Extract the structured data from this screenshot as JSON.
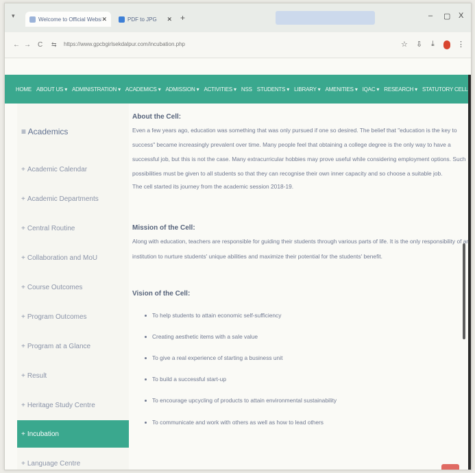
{
  "browser": {
    "tabs": [
      {
        "label": "Welcome to Official Website o",
        "close": "✕"
      },
      {
        "label": "PDF to JPG",
        "close": "✕"
      }
    ],
    "new_tab": "+",
    "window_controls": {
      "minimize": "–",
      "maximize": "▢",
      "close": "X"
    },
    "url": "https://www.gpcbgirlsekdalpur.com/incubation.php",
    "nav": {
      "back": "←",
      "forward": "→",
      "reload": "C",
      "site_info": "⇆"
    },
    "icons": {
      "star": "☆",
      "extensions": "⇩",
      "downloads": "⤓",
      "menu": "⋮"
    }
  },
  "site_nav": [
    "HOME",
    "ABOUT US ▾",
    "ADMINISTRATION ▾",
    "ACADEMICS ▾",
    "ADMISSION ▾",
    "ACTIVITIES ▾",
    "NSS",
    "STUDENTS ▾",
    "LIBRARY ▾",
    "AMENITIES ▾",
    "IQAC ▾",
    "RESEARCH ▾",
    "STATUTORY CELLS ▾"
  ],
  "sidebar": {
    "title": "≡ Academics",
    "items": [
      "Academic Calendar",
      "Academic Departments",
      "Central Routine",
      "Collaboration and MoU",
      "Course Outcomes",
      "Program Outcomes",
      "Program at a Glance",
      "Result",
      "Heritage Study Centre",
      "Incubation",
      "Language Centre"
    ],
    "active_index": 9
  },
  "content": {
    "about_heading": "About the Cell:",
    "about_lines": [
      "Even a few years ago, education was something that was only pursued if one so desired. The belief that \"education is the key to",
      "success\" became increasingly prevalent over time. Many people feel that obtaining a college degree is the only way to have a",
      "successful job, but this is not the case. Many extracurricular hobbies may prove useful while considering employment options. Such",
      "possibilities must be given to all students so that they can recognise their own inner capacity and so choose a suitable job.",
      "The cell started its journey from the academic session 2018-19."
    ],
    "mission_heading": "Mission of the Cell:",
    "mission_lines": [
      "Along with education, teachers are responsible for guiding their students through various parts of life. It is the only responsibility of an",
      "institution to nurture students' unique abilities and maximize their potential for the students' benefit."
    ],
    "vision_heading": "Vision of the Cell:",
    "vision_items": [
      "To help students to attain economic self-sufficiency",
      "Creating aesthetic items with a sale value",
      "To give a real experience of starting a business unit",
      "To build a successful start-up",
      "To encourage upcycling of products to attain environmental sustainability",
      "To communicate and work with others as well as how to lead others"
    ]
  },
  "colors": {
    "nav_green": "#3aa88e",
    "text": "#6f7890",
    "heading": "#55627a"
  }
}
